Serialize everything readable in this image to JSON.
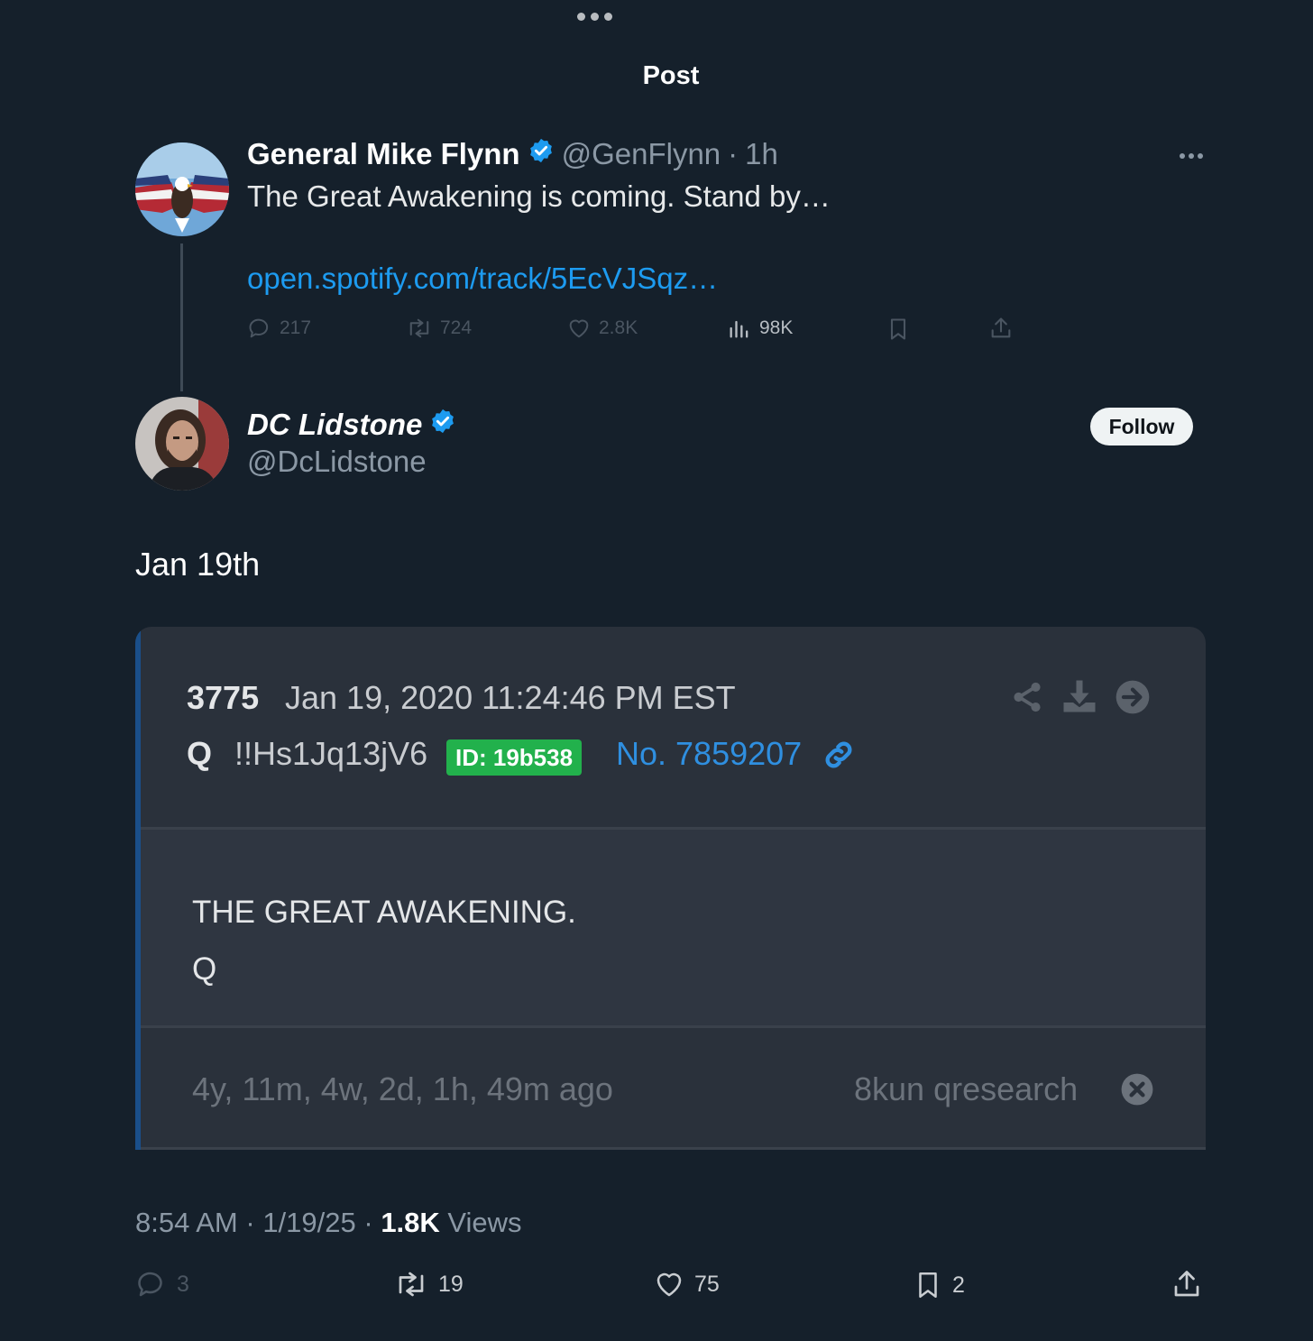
{
  "header": {
    "title": "Post"
  },
  "quoted_tweet": {
    "name": "General Mike Flynn",
    "handle": "@GenFlynn",
    "separator": "·",
    "time": "1h",
    "text": "The Great Awakening is coming. Stand by…",
    "link": "open.spotify.com/track/5EcVJSqz…",
    "stats": {
      "replies": "217",
      "retweets": "724",
      "likes": "2.8K",
      "views": "98K"
    }
  },
  "main_tweet": {
    "name": "DC Lidstone",
    "handle": "@DcLidstone",
    "follow_label": "Follow",
    "text": "Jan 19th",
    "timestamp_time": "8:54 AM",
    "timestamp_date": "1/19/25",
    "views_count": "1.8K",
    "views_label": "Views",
    "stats": {
      "replies": "3",
      "retweets": "19",
      "likes": "75",
      "bookmarks": "2"
    }
  },
  "qdrop": {
    "number": "3775",
    "date": "Jan 19, 2020 11:24:46 PM EST",
    "poster": "Q",
    "tripcode": "!!Hs1Jq13jV6",
    "id_badge": "ID: 19b538",
    "post_no": "No. 7859207",
    "body_line1": "THE GREAT AWAKENING.",
    "body_line2": "Q",
    "ago": "4y, 11m, 4w, 2d, 1h, 49m ago",
    "source": "8kun qresearch"
  },
  "colors": {
    "background": "#15202b",
    "accent": "#1d9bf0",
    "id_badge": "#22b14c"
  }
}
